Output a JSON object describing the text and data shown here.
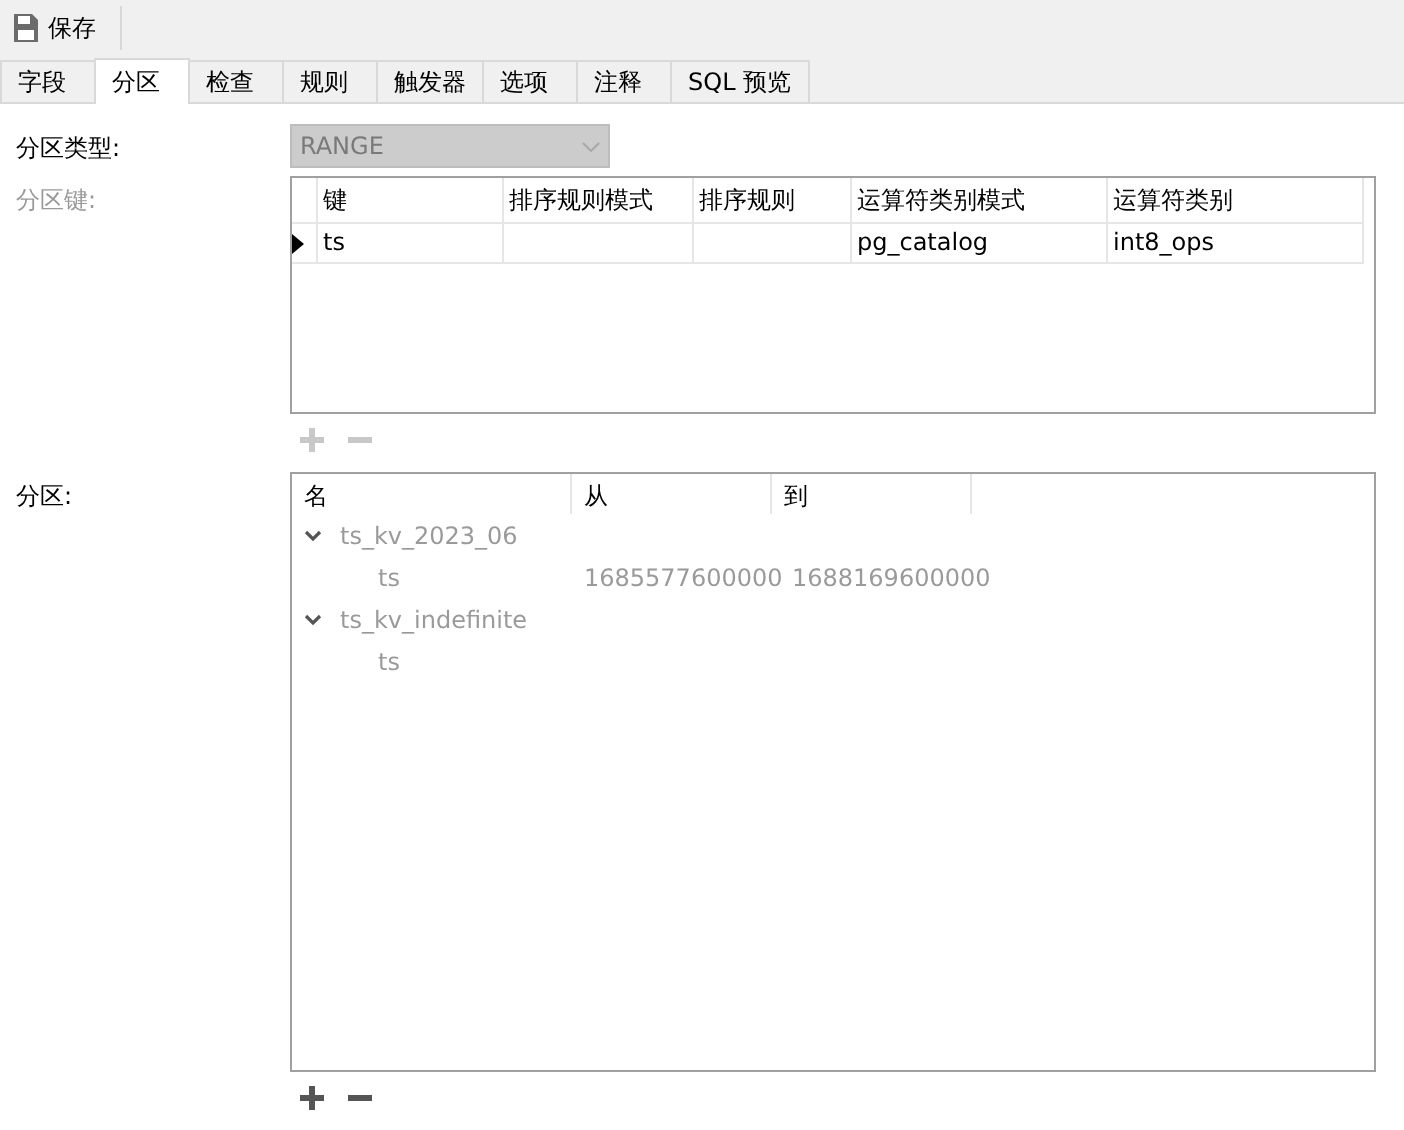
{
  "toolbar": {
    "save_label": "保存"
  },
  "tabs": [
    {
      "label": "字段",
      "selected": false
    },
    {
      "label": "分区",
      "selected": true
    },
    {
      "label": "检查",
      "selected": false
    },
    {
      "label": "规则",
      "selected": false
    },
    {
      "label": "触发器",
      "selected": false
    },
    {
      "label": "选项",
      "selected": false
    },
    {
      "label": "注释",
      "selected": false
    },
    {
      "label": "SQL 预览",
      "selected": false
    }
  ],
  "partition_type": {
    "label": "分区类型:",
    "value": "RANGE",
    "disabled": true
  },
  "partition_key": {
    "label": "分区键:",
    "disabled": true,
    "columns": [
      "键",
      "排序规则模式",
      "排序规则",
      "运算符类别模式",
      "运算符类别"
    ],
    "rows": [
      {
        "selected": true,
        "cells": [
          "ts",
          null,
          null,
          "pg_catalog",
          "int8_ops"
        ]
      }
    ],
    "buttons_disabled": true
  },
  "partitions": {
    "label": "分区:",
    "disabled": true,
    "columns": [
      "名",
      "从",
      "到"
    ],
    "items": [
      {
        "name": "ts_kv_2023_06",
        "expanded": true,
        "children": [
          {
            "name": "ts",
            "from": "1685577600000",
            "to": "1688169600000"
          }
        ]
      },
      {
        "name": "ts_kv_indefinite",
        "expanded": true,
        "children": [
          {
            "name": "ts"
          }
        ]
      }
    ],
    "buttons_disabled": false
  }
}
